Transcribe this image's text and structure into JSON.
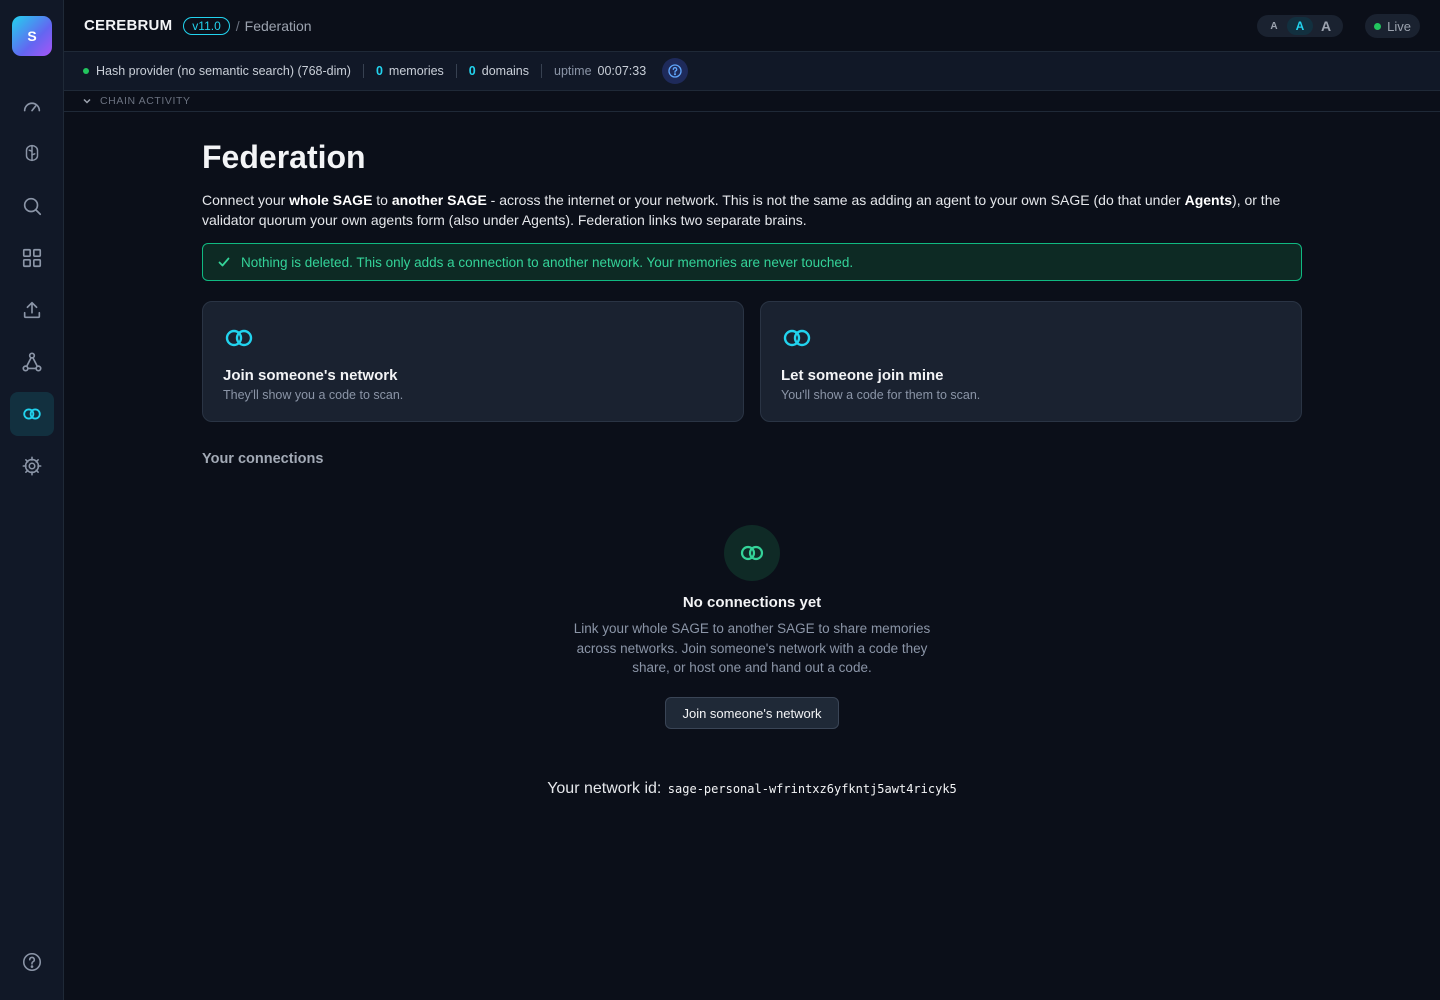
{
  "app": {
    "logo_letter": "S",
    "brand": "CEREBRUM",
    "version": "v11.0",
    "crumb_sep": "/",
    "breadcrumb": "Federation",
    "accent": "#22d3ee"
  },
  "sidebar": {
    "items": [
      {
        "icon": "gauge-icon",
        "label": "Dashboard"
      },
      {
        "icon": "brain-icon",
        "label": "Brain"
      },
      {
        "icon": "search-icon",
        "label": "Search"
      },
      {
        "icon": "grid-icon",
        "label": "Domains"
      },
      {
        "icon": "upload-icon",
        "label": "Import"
      },
      {
        "icon": "network-icon",
        "label": "Network"
      },
      {
        "icon": "federation-icon",
        "label": "Federation",
        "active": true
      },
      {
        "icon": "gear-icon",
        "label": "Settings"
      },
      {
        "icon": "help-icon",
        "label": "Help"
      }
    ]
  },
  "header": {
    "font_sizes": [
      "A",
      "A",
      "A"
    ],
    "selected_font_size": "medium",
    "live_label": "Live"
  },
  "status": {
    "provider": "Hash provider (no semantic search) (768-dim)",
    "memories_count": "0",
    "memories_label": "memories",
    "domains_count": "0",
    "domains_label": "domains",
    "uptime_label": "uptime",
    "uptime_value": "00:07:33",
    "chain_activity": "CHAIN ACTIVITY"
  },
  "main": {
    "title": "Federation",
    "intro": {
      "p1": "Connect your ",
      "b1": "whole SAGE",
      "p2": " to ",
      "b2": "another SAGE",
      "p3": " - across the internet or your network. This is not the same as adding an agent to your own SAGE (do that under ",
      "b3": "Agents",
      "p4": "), or the validator quorum your own agents form (also under Agents). Federation links two separate brains."
    },
    "notice": "Nothing is deleted. This only adds a connection to another network. Your memories are never touched.",
    "cards": [
      {
        "title": "Join someone's network",
        "subtitle": "They'll show you a code to scan."
      },
      {
        "title": "Let someone join mine",
        "subtitle": "You'll show a code for them to scan."
      }
    ],
    "connections_heading": "Your connections",
    "empty": {
      "title": "No connections yet",
      "text": "Link your whole SAGE to another SAGE to share memories across networks. Join someone's network with a code they share, or host one and hand out a code.",
      "button": "Join someone's network"
    },
    "network_id_label": "Your network id:",
    "network_id": "sage-personal-wfrintxz6yfkntj5awt4ricyk5"
  }
}
